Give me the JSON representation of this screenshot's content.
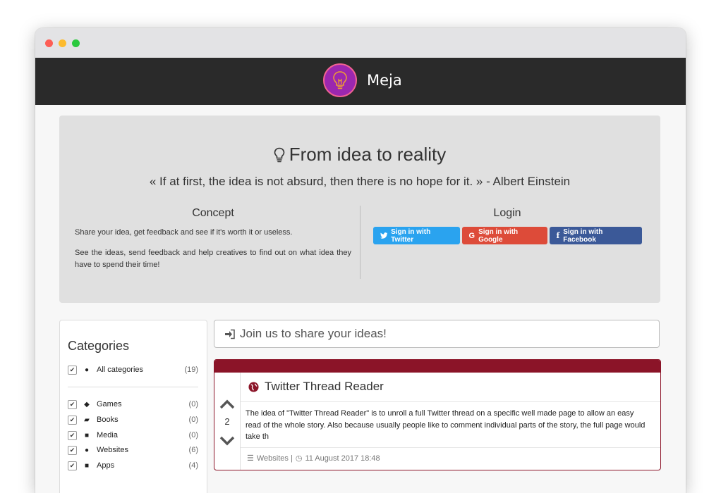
{
  "app": {
    "name": "Meja"
  },
  "hero": {
    "title": "From idea to reality",
    "quote": "« If at first, the idea is not absurd, then there is no hope for it. » - Albert Einstein",
    "concept_title": "Concept",
    "concept_p1": "Share your idea, get feedback and see if it's worth it or useless.",
    "concept_p2": "See the ideas, send feedback and help creatives to find out on what idea they have to spend their time!",
    "login_title": "Login",
    "twitter_label": "Sign in with Twitter",
    "google_label": "Sign in with Google",
    "facebook_label": "Sign in with Facebook"
  },
  "sidebar": {
    "title": "Categories",
    "all": {
      "label": "All categories",
      "count": "(19)"
    },
    "items": [
      {
        "label": "Games",
        "count": "(0)",
        "icon": "gamepad-icon"
      },
      {
        "label": "Books",
        "count": "(0)",
        "icon": "book-icon"
      },
      {
        "label": "Media",
        "count": "(0)",
        "icon": "video-camera-icon"
      },
      {
        "label": "Websites",
        "count": "(6)",
        "icon": "globe-icon"
      },
      {
        "label": "Apps",
        "count": "(4)",
        "icon": "app-square-icon"
      }
    ]
  },
  "join": {
    "label": "Join us to share your ideas!"
  },
  "idea": {
    "title": "Twitter Thread Reader",
    "votes": "2",
    "description": "The idea of \"Twitter Thread Reader\" is to unroll a full Twitter thread on a specific well made page to allow an easy read of the whole story. Also because usually people like to comment individual parts of the story, the full page would take th",
    "category": "Websites |",
    "date": "11 August 2017 18:48"
  },
  "colors": {
    "navbar": "#2a2a2a",
    "accent": "#8b1428",
    "twitter": "#2aa3ef",
    "google": "#dd4b39",
    "facebook": "#3b5998",
    "logo": "#9b27af"
  }
}
